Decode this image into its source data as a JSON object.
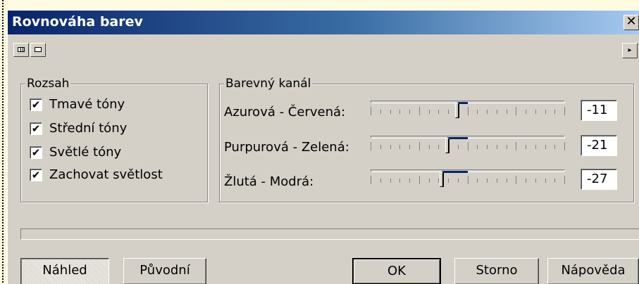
{
  "window": {
    "title": "Rovnováha barev",
    "close_label": "✕"
  },
  "toolbar": {
    "arrow_label": "▸"
  },
  "range_group": {
    "label": "Rozsah",
    "items": [
      {
        "label": "Tmavé tóny",
        "check": "✔"
      },
      {
        "label": "Střední tóny",
        "check": "✔"
      },
      {
        "label": "Světlé tóny",
        "check": "✔"
      },
      {
        "label": "Zachovat světlost",
        "check": "✔"
      }
    ]
  },
  "channel_group": {
    "label": "Barevný kanál",
    "channels": [
      {
        "label": "Azurová - Červená:",
        "value": "-11",
        "level": -11
      },
      {
        "label": "Purpurová - Zelená:",
        "value": "-21",
        "level": -21
      },
      {
        "label": "Žlutá - Modrá:",
        "value": "-27",
        "level": -27
      }
    ],
    "slider_range": [
      -100,
      100
    ]
  },
  "buttons": {
    "preview": "Náhled",
    "original": "Původní",
    "ok": "OK",
    "cancel": "Storno",
    "help": "Nápověda"
  },
  "colors": {
    "title_bar_start": "#0a246a",
    "title_bar_end": "#a6caf0",
    "dialog_face": "#d4d0c8",
    "background": "#fffbe0"
  }
}
